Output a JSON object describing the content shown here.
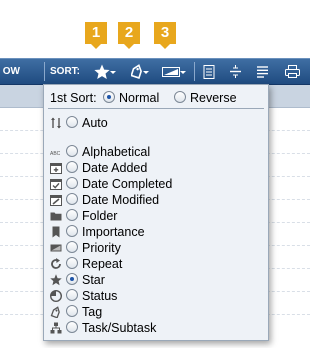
{
  "callouts": [
    "1",
    "2",
    "3"
  ],
  "toolbar": {
    "left_cut_text": "OW",
    "sort_label": "SORT:",
    "buttons": [
      {
        "icon": "star-icon"
      },
      {
        "icon": "tag-icon"
      },
      {
        "icon": "priority-icon"
      },
      {
        "icon": "document-icon"
      },
      {
        "icon": "align-center-icon"
      },
      {
        "icon": "align-justify-icon"
      },
      {
        "icon": "print-icon"
      }
    ]
  },
  "dropdown": {
    "first_sort_label": "1st Sort:",
    "direction_options": [
      {
        "label": "Normal",
        "selected": true
      },
      {
        "label": "Reverse",
        "selected": false
      }
    ],
    "auto": {
      "label": "Auto",
      "icon": "manual-sort-icon",
      "selected": false
    },
    "options": [
      {
        "label": "Alphabetical",
        "icon": "abc-icon",
        "selected": false
      },
      {
        "label": "Date Added",
        "icon": "calendar-plus-icon",
        "selected": false
      },
      {
        "label": "Date Completed",
        "icon": "calendar-check-icon",
        "selected": false
      },
      {
        "label": "Date Modified",
        "icon": "calendar-edit-icon",
        "selected": false
      },
      {
        "label": "Folder",
        "icon": "folder-icon",
        "selected": false
      },
      {
        "label": "Importance",
        "icon": "bookmark-icon",
        "selected": false
      },
      {
        "label": "Priority",
        "icon": "priority-icon",
        "selected": false
      },
      {
        "label": "Repeat",
        "icon": "repeat-icon",
        "selected": false
      },
      {
        "label": "Star",
        "icon": "star-icon",
        "selected": true
      },
      {
        "label": "Status",
        "icon": "clock-icon",
        "selected": false
      },
      {
        "label": "Tag",
        "icon": "tag-icon",
        "selected": false
      },
      {
        "label": "Task/Subtask",
        "icon": "hierarchy-icon",
        "selected": false
      }
    ]
  },
  "colors": {
    "accent": "#e8a71d",
    "toolbar": "#2d5a91",
    "menu_bg": "#eef2f7",
    "radio_dot": "#1f55a8"
  }
}
